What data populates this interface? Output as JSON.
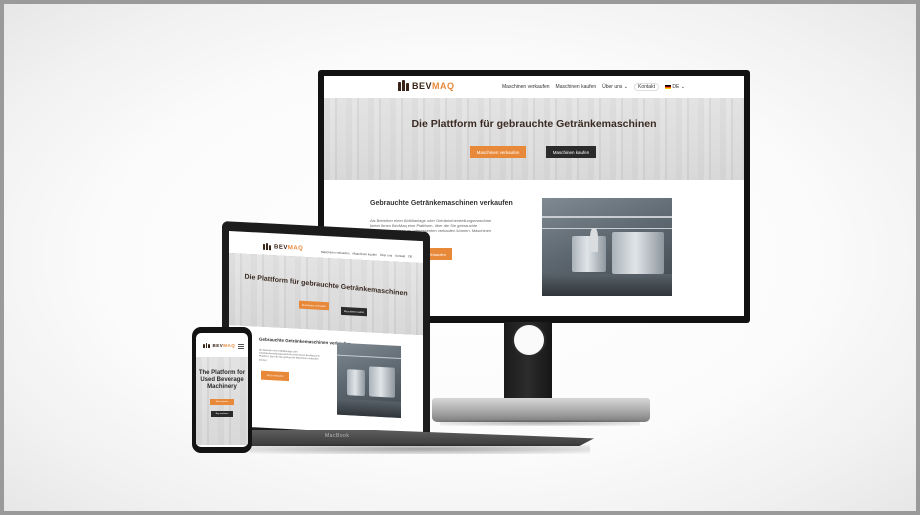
{
  "site": {
    "brand_main": "BEV",
    "brand_accent": "MAQ",
    "accent_color": "#e8893a",
    "dark_color": "#2b2b2b",
    "brand_color": "#3a2418"
  },
  "monitor": {
    "nav": {
      "links": [
        "Maschinen verkaufen",
        "Maschinen kaufen",
        "Über uns ⌄",
        "Kontakt"
      ],
      "language": "DE ⌄"
    },
    "hero": {
      "title": "Die Plattform für gebrauchte Getränkemaschinen",
      "primary_button": "Maschinen verkaufen",
      "secondary_button": "Maschinen kaufen"
    },
    "section": {
      "title": "Gebrauchte Getränkemaschinen verkaufen",
      "paragraph": "Als Betreiber einer Abfüllanlage oder Getränkeherstellungsmaschine bietet Ihnen BevMaq eine Plattform, über die Sie gebrauchte Getränkemaschinen an Interessenten verkaufen können. Maschinen können einfach gelistet werden.",
      "cta": "Verkaufen"
    }
  },
  "laptop": {
    "nav": {
      "links": [
        "Maschinen verkaufen",
        "Maschinen kaufen",
        "Über uns",
        "Kontakt",
        "DE"
      ]
    },
    "hero": {
      "title": "Die Plattform für gebrauchte Getränkemaschinen",
      "primary_button": "Maschinen verkaufen",
      "secondary_button": "Maschinen kaufen"
    },
    "section": {
      "title": "Gebrauchte Getränkemaschinen verkaufen",
      "paragraph": "Als Betreiber einer Abfüllanlage oder Getränkeherstellungsmaschine bietet Ihnen BevMaq eine Plattform, über die Sie gebrauchte Maschinen verkaufen können.",
      "cta": "Jetzt verkaufen"
    },
    "device_label": "MacBook"
  },
  "phone": {
    "hero": {
      "title": "The Platform for Used Beverage Machinery",
      "primary_button": "Sell machines",
      "secondary_button": "Buy machines"
    }
  }
}
